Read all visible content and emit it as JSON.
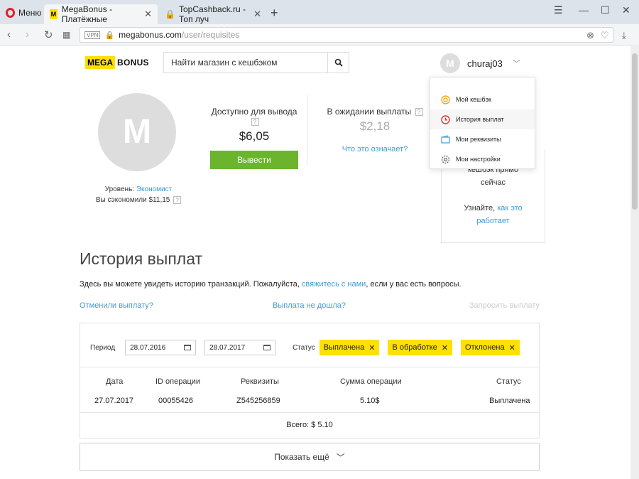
{
  "browser": {
    "menu_label": "Меню",
    "tabs": [
      {
        "title": "MegaBonus - Платёжные",
        "favicon": "M"
      },
      {
        "title": "TopCashback.ru - Топ луч",
        "favicon": "lock-icon"
      }
    ],
    "url_host": "megabonus.com",
    "url_path": "/user/requisites",
    "vpn_badge": "VPN"
  },
  "header": {
    "logo_part1": "MEGA",
    "logo_part2": "BONUS",
    "search_placeholder": "Найти магазин с кешбэком",
    "user_initial": "M",
    "username": "churaj03"
  },
  "dropdown": {
    "items": [
      {
        "label": "Мой кешбэк",
        "icon": "cashback-icon"
      },
      {
        "label": "История выплат",
        "icon": "clock-icon"
      },
      {
        "label": "Мои реквизиты",
        "icon": "wallet-icon"
      },
      {
        "label": "Мои настройки",
        "icon": "gear-icon"
      }
    ]
  },
  "profile": {
    "initial": "M",
    "level_label": "Уровень:",
    "level_value": "Экономист",
    "saved_label": "Вы сэкономили $11,15"
  },
  "balance": {
    "available_label": "Доступно для вывода",
    "available_amount": "$6,05",
    "withdraw_button": "Вывести",
    "pending_label": "В ожидании выплаты",
    "pending_amount": "$2,18",
    "pending_link": "Что это означает?"
  },
  "promo": {
    "line1": "кешбэк прямо",
    "line2": "сейчас",
    "line3": "Узнайте,",
    "link": "как это",
    "link2": "работает"
  },
  "history": {
    "title": "История выплат",
    "intro_before": "Здесь вы можете увидеть историю транзакций. Пожалуйста,",
    "intro_link": "свяжитесь с нами",
    "intro_after": ", если у вас есть вопросы.",
    "link_cancel": "Отменили выплату?",
    "link_not_arrived": "Выплата не дошла?",
    "link_request": "Запросить выплату",
    "filters": {
      "period_label": "Период",
      "date_from": "28.07.2016",
      "date_to": "28.07.2017",
      "status_label": "Статус",
      "chips": [
        "Выплачена",
        "В обработке",
        "Отклонена"
      ]
    },
    "columns": [
      "Дата",
      "ID операции",
      "Реквизиты",
      "Сумма операции",
      "Статус"
    ],
    "rows": [
      {
        "date": "27.07.2017",
        "id": "00055426",
        "requisites": "Z545256859",
        "amount": "5.10$",
        "status": "Выплачена"
      }
    ],
    "total": "Всего: $ 5.10",
    "show_more": "Показать ещё"
  },
  "colors": {
    "brand_yellow": "#ffe000",
    "button_green": "#6ab42e",
    "link_blue": "#3d9bd6"
  }
}
